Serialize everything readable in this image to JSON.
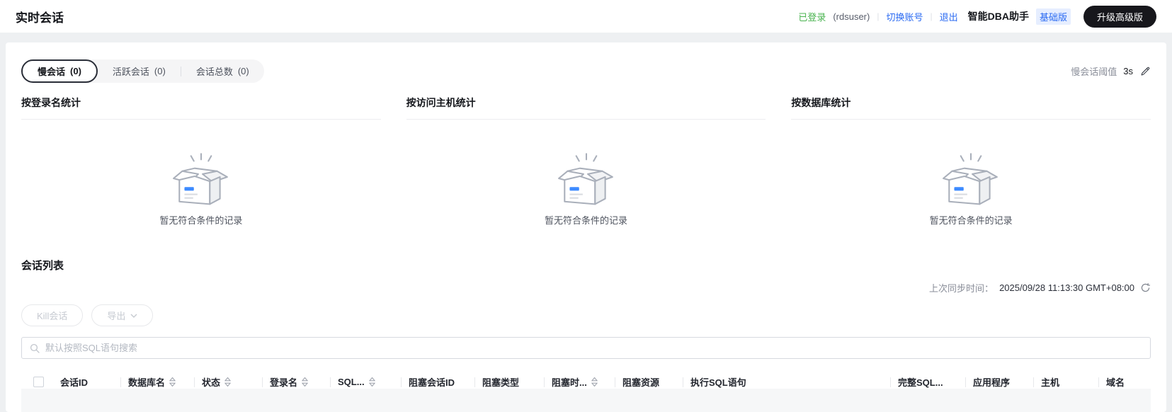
{
  "page": {
    "title": "实时会话"
  },
  "header": {
    "login_status": "已登录",
    "login_user": "(rdsuser)",
    "switch_account": "切换账号",
    "logout": "退出",
    "app_name": "智能DBA助手",
    "edition_badge": "基础版",
    "upgrade_button": "升级高级版"
  },
  "tabs": [
    {
      "label": "慢会话",
      "count": "(0)",
      "active": true
    },
    {
      "label": "活跃会话",
      "count": "(0)",
      "active": false
    },
    {
      "label": "会话总数",
      "count": "(0)",
      "active": false
    }
  ],
  "threshold": {
    "label": "慢会话阈值",
    "value": "3s",
    "edit_icon": "pencil-icon"
  },
  "stats_sections": [
    {
      "title": "按登录名统计",
      "empty_text": "暂无符合条件的记录",
      "icon": "empty-box-icon"
    },
    {
      "title": "按访问主机统计",
      "empty_text": "暂无符合条件的记录",
      "icon": "empty-box-icon"
    },
    {
      "title": "按数据库统计",
      "empty_text": "暂无符合条件的记录",
      "icon": "empty-box-icon"
    }
  ],
  "session_list": {
    "title": "会话列表",
    "last_sync_label": "上次同步时间：",
    "last_sync_time": "2025/09/28 11:13:30 GMT+08:00",
    "refresh_icon": "refresh-icon",
    "kill_button": "Kill会话",
    "export_button": "导出",
    "search_placeholder": "默认按照SQL语句搜索",
    "columns": [
      {
        "label": "会话ID",
        "sortable": false
      },
      {
        "label": "数据库名",
        "sortable": true
      },
      {
        "label": "状态",
        "sortable": true
      },
      {
        "label": "登录名",
        "sortable": true
      },
      {
        "label": "SQL...",
        "sortable": true
      },
      {
        "label": "阻塞会话ID",
        "sortable": false
      },
      {
        "label": "阻塞类型",
        "sortable": false
      },
      {
        "label": "阻塞时...",
        "sortable": true
      },
      {
        "label": "阻塞资源",
        "sortable": false
      },
      {
        "label": "执行SQL语句",
        "sortable": false
      },
      {
        "label": "完整SQL...",
        "sortable": false
      },
      {
        "label": "应用程序",
        "sortable": false
      },
      {
        "label": "主机",
        "sortable": false
      },
      {
        "label": "域名",
        "sortable": false
      }
    ],
    "rows": []
  },
  "colors": {
    "accent_blue": "#2a6af2",
    "login_green": "#49b34f",
    "upgrade_black": "#17171c",
    "empty_box_blue": "#3d8bff",
    "muted_gray": "#8a8e99"
  }
}
